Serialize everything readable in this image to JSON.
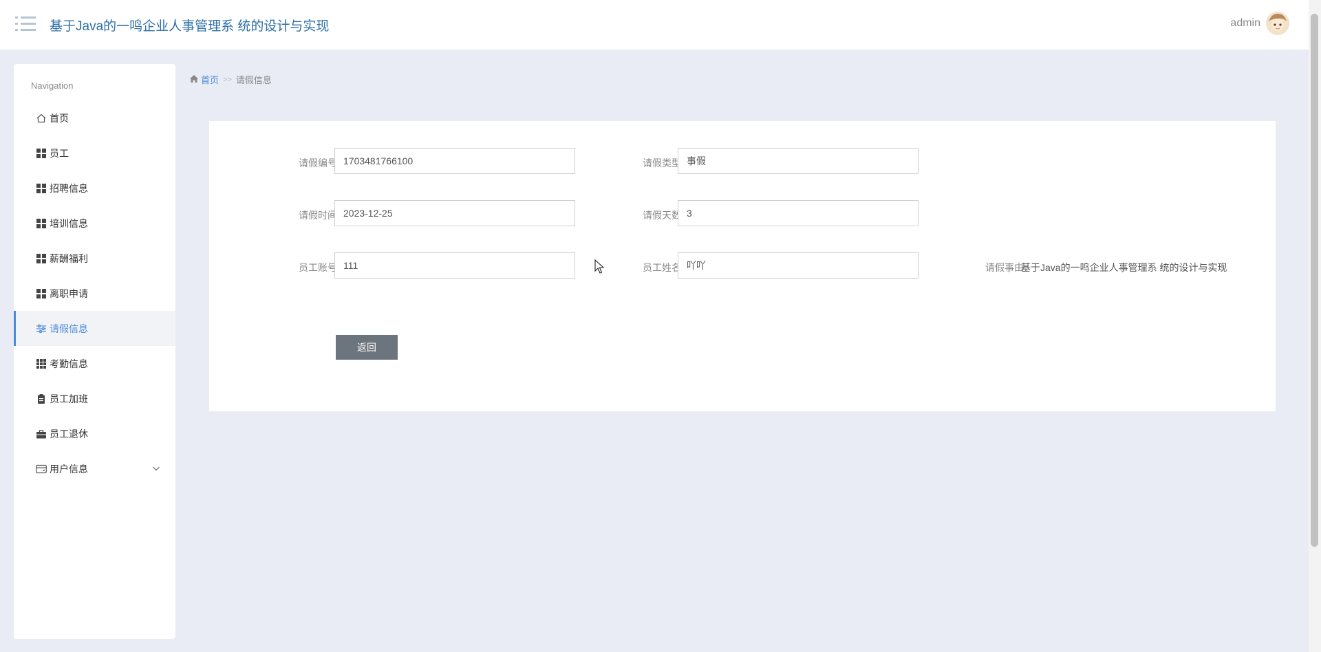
{
  "header": {
    "title": "基于Java的一鸣企业人事管理系 统的设计与实现",
    "user": "admin"
  },
  "sidebar": {
    "heading": "Navigation",
    "items": [
      {
        "label": "首页",
        "icon": "home-icon"
      },
      {
        "label": "员工",
        "icon": "grid-icon"
      },
      {
        "label": "招聘信息",
        "icon": "grid-icon"
      },
      {
        "label": "培训信息",
        "icon": "grid-icon"
      },
      {
        "label": "薪酬福利",
        "icon": "grid-icon"
      },
      {
        "label": "离职申请",
        "icon": "grid-icon"
      },
      {
        "label": "请假信息",
        "icon": "sliders-icon",
        "active": true
      },
      {
        "label": "考勤信息",
        "icon": "grid9-icon"
      },
      {
        "label": "员工加班",
        "icon": "clipboard-icon"
      },
      {
        "label": "员工退休",
        "icon": "briefcase-icon"
      },
      {
        "label": "用户信息",
        "icon": "card-icon"
      }
    ]
  },
  "breadcrumb": {
    "home": "首页",
    "separator": ">>",
    "current": "请假信息"
  },
  "form": {
    "leave_number": {
      "label": "请假编号",
      "value": "1703481766100"
    },
    "leave_type": {
      "label": "请假类型",
      "value": "事假"
    },
    "leave_time": {
      "label": "请假时间",
      "value": "2023-12-25"
    },
    "leave_days": {
      "label": "请假天数",
      "value": "3"
    },
    "employee_account": {
      "label": "员工账号",
      "value": "111"
    },
    "employee_name": {
      "label": "员工姓名",
      "value": "吖吖"
    },
    "leave_reason": {
      "label": "请假事由",
      "value": "基于Java的一鸣企业人事管理系 统的设计与实现"
    },
    "back_button": "返回"
  },
  "colors": {
    "accent": "#4c8bd8",
    "title": "#2e6fa6",
    "background": "#e9ebf5",
    "button": "#6c757d"
  }
}
